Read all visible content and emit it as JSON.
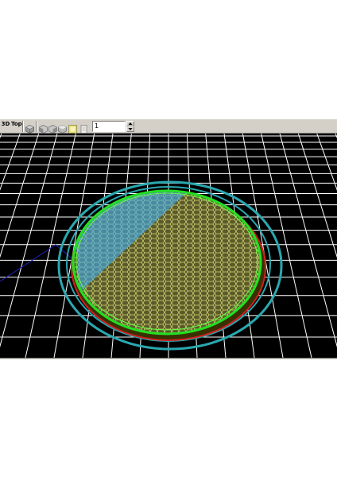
{
  "toolbar": {
    "view_3d_label": "3D",
    "view_top_label": "Top",
    "layer_value": "1",
    "icons": [
      "cube-view-icon",
      "front-view-icon",
      "side-view-icon",
      "iso-view-icon",
      "highlight-view-icon",
      "page-view-icon"
    ]
  },
  "viewport": {
    "background_color": "#000000",
    "grid_color": "#ffffff",
    "skirt_color": "#2aa8b0",
    "perimeter_color": "#22e022",
    "infill_color": "#d8d878",
    "travel_color": "#2020c0",
    "highlight_fill_color": "#7fc8d8"
  }
}
